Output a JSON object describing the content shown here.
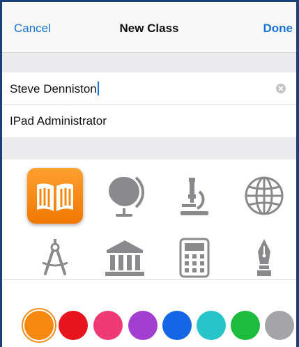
{
  "nav": {
    "cancel_label": "Cancel",
    "title": "New Class",
    "done_label": "Done"
  },
  "form": {
    "class_name_value": "Steve Denniston",
    "description_value": "IPad Administrator"
  },
  "icons": [
    {
      "name": "book-icon",
      "selected": true
    },
    {
      "name": "globe-icon",
      "selected": false
    },
    {
      "name": "microscope-icon",
      "selected": false
    },
    {
      "name": "world-grid-icon",
      "selected": false
    },
    {
      "name": "compass-icon",
      "selected": false
    },
    {
      "name": "columns-building-icon",
      "selected": false
    },
    {
      "name": "calculator-icon",
      "selected": false
    },
    {
      "name": "pen-nib-icon",
      "selected": false
    }
  ],
  "colors": [
    {
      "name": "orange",
      "hex": "#f7890f",
      "selected": true
    },
    {
      "name": "red",
      "hex": "#e8141c",
      "selected": false
    },
    {
      "name": "pink",
      "hex": "#f03a74",
      "selected": false
    },
    {
      "name": "purple",
      "hex": "#a23fd0",
      "selected": false
    },
    {
      "name": "blue",
      "hex": "#1466e6",
      "selected": false
    },
    {
      "name": "teal",
      "hex": "#27c4c8",
      "selected": false
    },
    {
      "name": "green",
      "hex": "#1ebc3e",
      "selected": false
    },
    {
      "name": "gray",
      "hex": "#a5a5a8",
      "selected": false
    }
  ],
  "accent_color": "#1a74d6"
}
